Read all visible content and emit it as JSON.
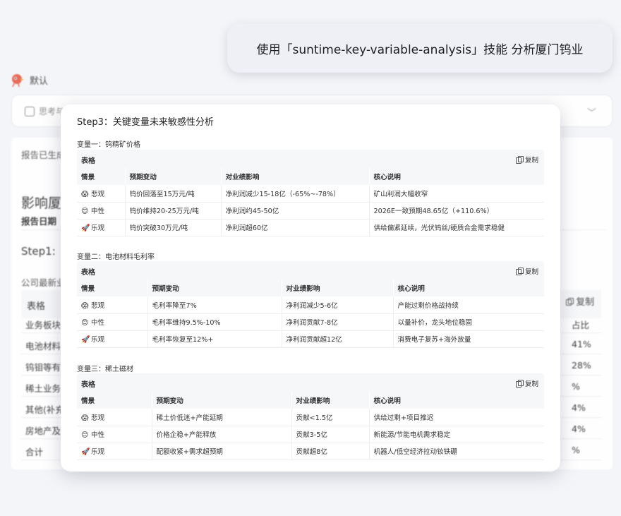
{
  "prompt": "使用「suntime-key-variable-analysis」技能 分析厦门钨业",
  "background": {
    "model_label": "默认",
    "input_placeholder": "思考与",
    "report_status": "报告已生成",
    "report_title": "影响厦",
    "report_date": "报告日期",
    "step1": "Step1:",
    "latest": "公司最新业",
    "table_label": "表格",
    "copy_label": "复制",
    "rows": [
      {
        "c1": "业务板块",
        "c2": "占比"
      },
      {
        "c1": "电池材料",
        "c2": "41%"
      },
      {
        "c1": "钨钼等有",
        "c2": "28%"
      },
      {
        "c1": "稀土业务",
        "c2": "%"
      },
      {
        "c1": "其他(补充",
        "c2": "4%"
      },
      {
        "c1": "房地产及",
        "c2": "4%"
      },
      {
        "c1": "合计",
        "c2": "%"
      }
    ]
  },
  "card": {
    "title": "Step3：关键变量未来敏感性分析",
    "table_label": "表格",
    "copy_label": "复制",
    "variables": [
      {
        "title": "变量一：钨精矿价格",
        "headers": [
          "情景",
          "预期变动",
          "对业绩影响",
          "核心说明"
        ],
        "rows": [
          {
            "emoji": "😱",
            "scenario": "悲观",
            "change": "钨价回落至15万元/吨",
            "impact": "净利润减少15-18亿（-65%~-78%）",
            "note": "矿山利润大幅收窄"
          },
          {
            "emoji": "😊",
            "scenario": "中性",
            "change": "钨价维持20-25万元/吨",
            "impact": "净利润约45-50亿",
            "note": "2026E一致预期48.65亿（+110.6%）"
          },
          {
            "emoji": "🚀",
            "scenario": "乐观",
            "change": "钨价突破30万元/吨",
            "impact": "净利润超60亿",
            "note": "供给偏紧延续，光伏钨丝/硬质合金需求稳健"
          }
        ]
      },
      {
        "title": "变量二：电池材料毛利率",
        "headers": [
          "情景",
          "预期变动",
          "对业绩影响",
          "核心说明"
        ],
        "rows": [
          {
            "emoji": "😱",
            "scenario": "悲观",
            "change": "毛利率降至7%",
            "impact": "净利润减少5-6亿",
            "note": "产能过剩价格战持续"
          },
          {
            "emoji": "😊",
            "scenario": "中性",
            "change": "毛利率维持9.5%-10%",
            "impact": "净利润贡献7-8亿",
            "note": "以量补价，龙头地位稳固"
          },
          {
            "emoji": "🚀",
            "scenario": "乐观",
            "change": "毛利率恢复至12%+",
            "impact": "净利润贡献超12亿",
            "note": "消费电子复苏+海外放量"
          }
        ]
      },
      {
        "title": "变量三：稀土磁材",
        "headers": [
          "情景",
          "预期变动",
          "对业绩影响",
          "核心说明"
        ],
        "rows": [
          {
            "emoji": "😱",
            "scenario": "悲观",
            "change": "稀土价低迷+产能延期",
            "impact": "贡献<1.5亿",
            "note": "供给过剩+项目推迟"
          },
          {
            "emoji": "😊",
            "scenario": "中性",
            "change": "价格企稳+产能释放",
            "impact": "贡献3-5亿",
            "note": "新能源/节能电机需求稳定"
          },
          {
            "emoji": "🚀",
            "scenario": "乐观",
            "change": "配额收紧+需求超预期",
            "impact": "贡献超8亿",
            "note": "机器人/低空经济拉动钕铁硼"
          }
        ]
      }
    ]
  }
}
